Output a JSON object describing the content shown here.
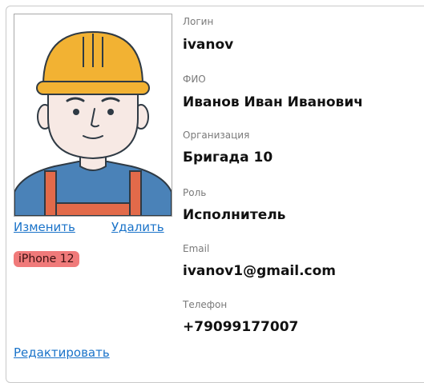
{
  "user": {
    "avatar_icon": "worker-avatar-icon",
    "change_link": "Изменить",
    "delete_link": "Удалить",
    "device_badge": "iPhone 12",
    "edit_link": "Редактировать",
    "fields": [
      {
        "label": "Логин",
        "value": "ivanov"
      },
      {
        "label": "ФИО",
        "value": "Иванов Иван Иванович"
      },
      {
        "label": "Организация",
        "value": "Бригада 10"
      },
      {
        "label": "Роль",
        "value": "Исполнитель"
      },
      {
        "label": "Email",
        "value": "ivanov1@gmail.com"
      },
      {
        "label": "Телефон",
        "value": "+79099177007"
      }
    ]
  },
  "colors": {
    "link": "#1a73c9",
    "badge": "#f07a7a",
    "helmet": "#f2b233",
    "shirt": "#4a82b8",
    "overalls": "#e26a4a"
  }
}
